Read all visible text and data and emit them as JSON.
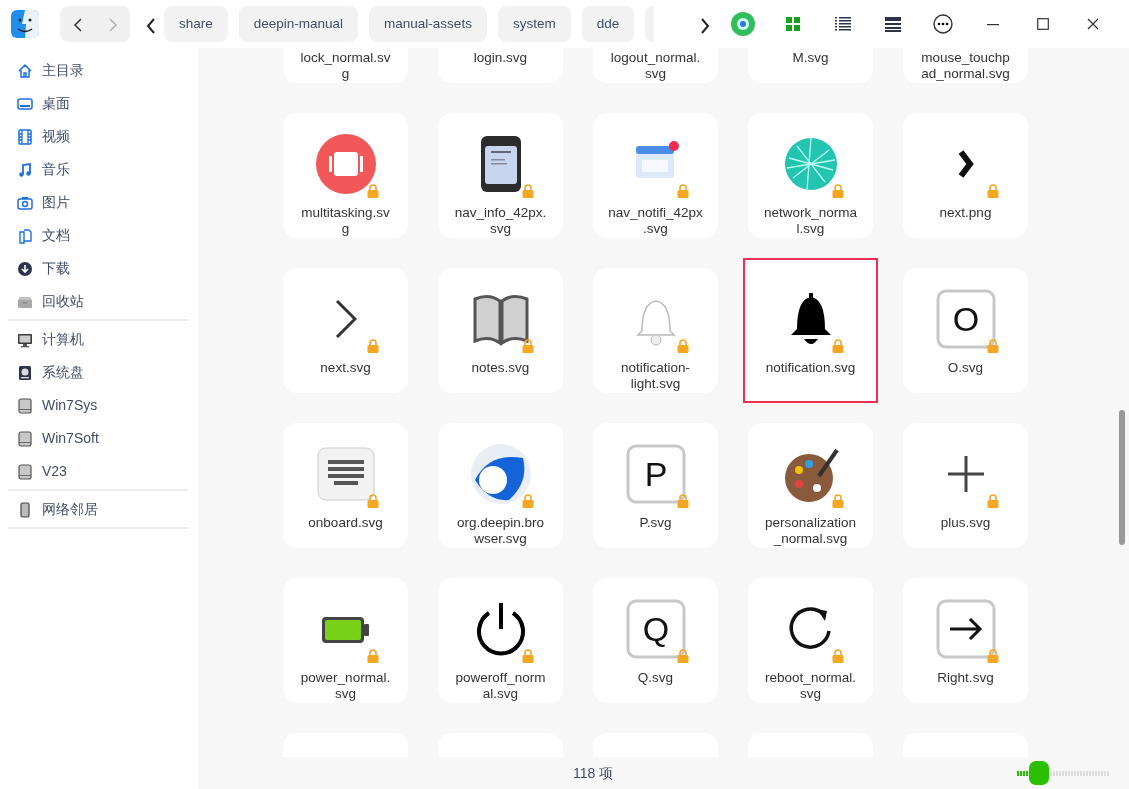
{
  "toolbar": {
    "back_disabled": false,
    "forward_disabled": true,
    "breadcrumbs": [
      {
        "label": "share"
      },
      {
        "label": "deepin-manual"
      },
      {
        "label": "manual-assets"
      },
      {
        "label": "system"
      },
      {
        "label": "dde"
      },
      {
        "kind": "cut"
      }
    ],
    "views": [
      {
        "kind": "icons",
        "selected": true
      },
      {
        "kind": "list",
        "selected": false
      },
      {
        "kind": "tree",
        "selected": false
      }
    ]
  },
  "sidebar": {
    "groups": [
      [
        {
          "label": "主目录",
          "kind": "home"
        },
        {
          "label": "桌面",
          "kind": "desktop"
        },
        {
          "label": "视频",
          "kind": "video"
        },
        {
          "label": "音乐",
          "kind": "music"
        },
        {
          "label": "图片",
          "kind": "picture"
        },
        {
          "label": "文档",
          "kind": "document"
        },
        {
          "label": "下载",
          "kind": "download"
        },
        {
          "label": "回收站",
          "kind": "trash"
        }
      ],
      [
        {
          "label": "计算机",
          "kind": "computer"
        },
        {
          "label": "系统盘",
          "kind": "system"
        },
        {
          "label": "Win7Sys",
          "kind": "drive"
        },
        {
          "label": "Win7Soft",
          "kind": "drive"
        },
        {
          "label": "V23",
          "kind": "drive"
        }
      ],
      [
        {
          "label": "网络邻居",
          "kind": "network"
        }
      ]
    ]
  },
  "files": [
    {
      "name": "lock_normal.sv\ng",
      "kind": "hidden",
      "selected": false
    },
    {
      "name": "login.svg",
      "kind": "hidden",
      "selected": false
    },
    {
      "name": "logout_normal.\nsvg",
      "kind": "hidden",
      "selected": false
    },
    {
      "name": "M.svg",
      "kind": "hidden",
      "selected": false
    },
    {
      "name": "mouse_touchp\nad_normal.svg",
      "kind": "hidden",
      "selected": false
    },
    {
      "name": "multitasking.sv\ng",
      "kind": "multitasking",
      "locked": true,
      "selected": false
    },
    {
      "name": "nav_info_42px.\nsvg",
      "kind": "card",
      "locked": true,
      "selected": false
    },
    {
      "name": "nav_notifi_42px\n.svg",
      "kind": "window",
      "locked": true,
      "selected": false
    },
    {
      "name": "network_norma\nl.svg",
      "kind": "globe",
      "locked": true,
      "selected": false
    },
    {
      "name": "next.png",
      "kind": "boldchevron",
      "locked": true,
      "selected": false
    },
    {
      "name": "next.svg",
      "kind": "chevron",
      "locked": true,
      "selected": false
    },
    {
      "name": "notes.svg",
      "kind": "book",
      "locked": true,
      "selected": false
    },
    {
      "name": "notification-\nlight.svg",
      "kind": "belllight",
      "locked": true,
      "selected": false
    },
    {
      "name": "notification.svg",
      "kind": "bell",
      "locked": true,
      "selected": true
    },
    {
      "name": "O.svg",
      "kind": "letter",
      "glyph": "O",
      "locked": true,
      "selected": false
    },
    {
      "name": "onboard.svg",
      "kind": "keyboard",
      "locked": true,
      "selected": false
    },
    {
      "name": "org.deepin.bro\nwser.svg",
      "kind": "browser",
      "locked": true,
      "selected": false
    },
    {
      "name": "P.svg",
      "kind": "letter",
      "glyph": "P",
      "locked": true,
      "selected": false
    },
    {
      "name": "personalization\n_normal.svg",
      "kind": "palette",
      "locked": true,
      "selected": false
    },
    {
      "name": "plus.svg",
      "kind": "plus",
      "locked": true,
      "selected": false
    },
    {
      "name": "power_normal.\nsvg",
      "kind": "battery",
      "locked": true,
      "selected": false
    },
    {
      "name": "poweroff_norm\nal.svg",
      "kind": "power",
      "locked": true,
      "selected": false
    },
    {
      "name": "Q.svg",
      "kind": "letter",
      "glyph": "Q",
      "locked": true,
      "selected": false
    },
    {
      "name": "reboot_normal.\nsvg",
      "kind": "reboot",
      "locked": true,
      "selected": false
    },
    {
      "name": "Right.svg",
      "kind": "arrow",
      "locked": true,
      "selected": false
    }
  ],
  "status_bar": {
    "count": "118 项",
    "zoom": {
      "level": 0.13
    }
  }
}
